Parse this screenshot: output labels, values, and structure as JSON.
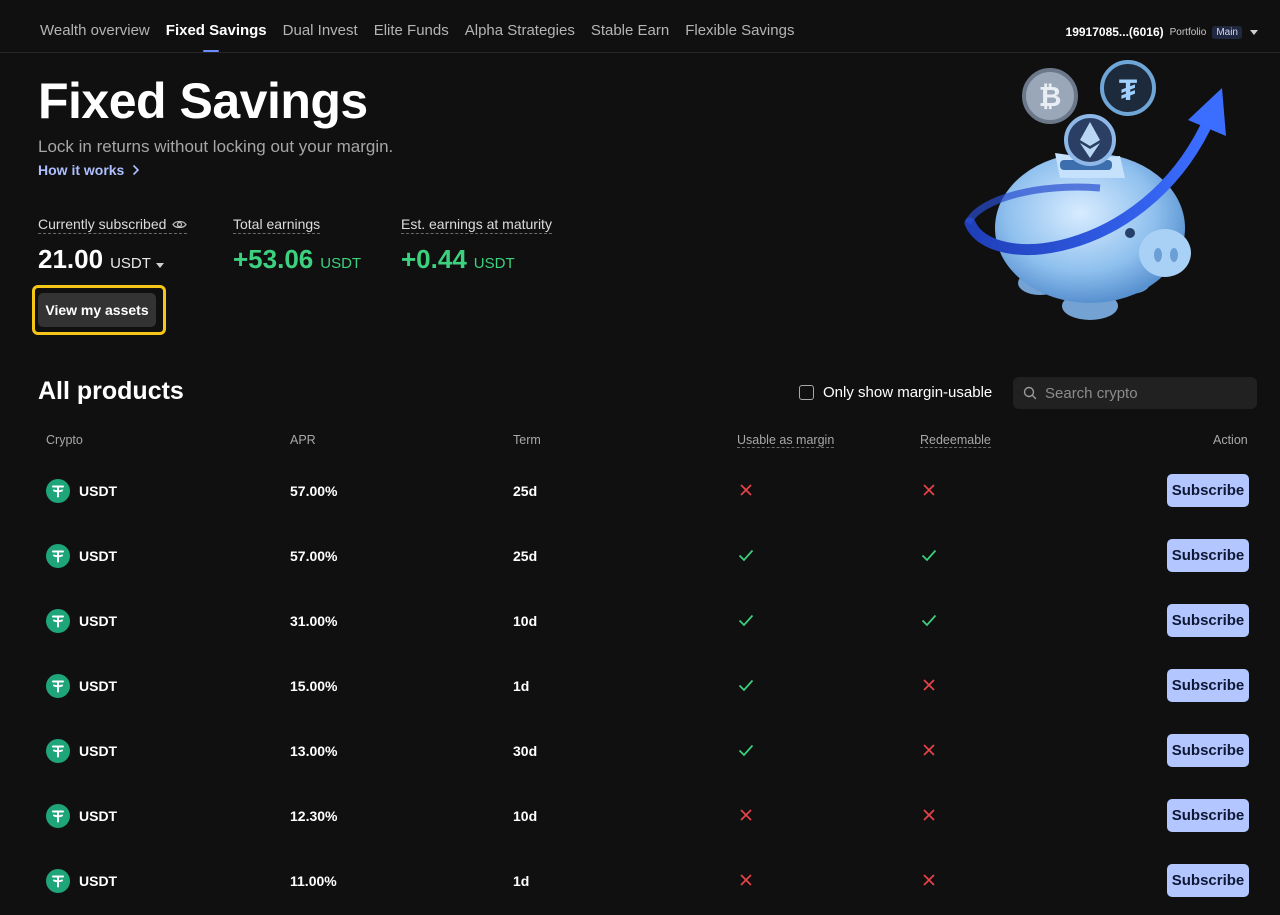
{
  "nav": {
    "tabs": [
      "Wealth overview",
      "Fixed Savings",
      "Dual Invest",
      "Elite Funds",
      "Alpha Strategies",
      "Stable Earn",
      "Flexible Savings"
    ],
    "active_tab": "Fixed Savings",
    "account_id": "19917085...(6016)",
    "portfolio_label": "Portfolio",
    "account_badge": "Main"
  },
  "hero": {
    "title": "Fixed Savings",
    "subtitle": "Lock in returns without locking out your margin.",
    "how_link": "How it works"
  },
  "stats": {
    "subscribed_label": "Currently subscribed",
    "subscribed_value": "21.00",
    "subscribed_unit": "USDT",
    "total_label": "Total earnings",
    "total_value": "+53.06",
    "total_unit": "USDT",
    "est_label": "Est. earnings at maturity",
    "est_value": "+0.44",
    "est_unit": "USDT"
  },
  "view_assets_label": "View my assets",
  "products": {
    "title": "All products",
    "filter_label": "Only show margin-usable",
    "search_placeholder": "Search crypto",
    "columns": {
      "crypto": "Crypto",
      "apr": "APR",
      "term": "Term",
      "margin": "Usable as margin",
      "redeemable": "Redeemable",
      "action": "Action"
    },
    "rows": [
      {
        "crypto": "USDT",
        "apr": "57.00%",
        "term": "25d",
        "margin": false,
        "redeemable": false,
        "action": "Subscribe"
      },
      {
        "crypto": "USDT",
        "apr": "57.00%",
        "term": "25d",
        "margin": true,
        "redeemable": true,
        "action": "Subscribe"
      },
      {
        "crypto": "USDT",
        "apr": "31.00%",
        "term": "10d",
        "margin": true,
        "redeemable": true,
        "action": "Subscribe"
      },
      {
        "crypto": "USDT",
        "apr": "15.00%",
        "term": "1d",
        "margin": true,
        "redeemable": false,
        "action": "Subscribe"
      },
      {
        "crypto": "USDT",
        "apr": "13.00%",
        "term": "30d",
        "margin": true,
        "redeemable": false,
        "action": "Subscribe"
      },
      {
        "crypto": "USDT",
        "apr": "12.30%",
        "term": "10d",
        "margin": false,
        "redeemable": false,
        "action": "Subscribe"
      },
      {
        "crypto": "USDT",
        "apr": "11.00%",
        "term": "1d",
        "margin": false,
        "redeemable": false,
        "action": "Subscribe"
      }
    ]
  },
  "colors": {
    "positive": "#3cd17f",
    "check": "#3cd17f",
    "cross": "#e8434a",
    "accent_button": "#b3c6ff",
    "highlight_outline": "#f5c518"
  }
}
